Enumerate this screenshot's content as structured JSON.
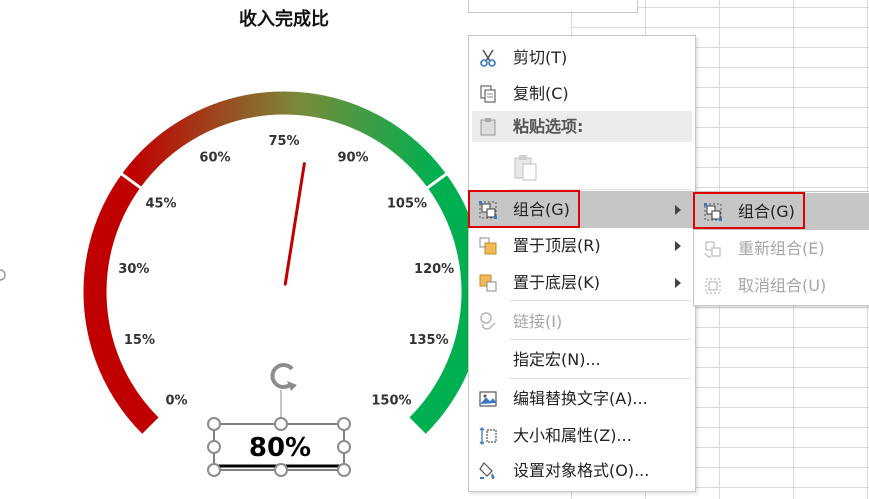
{
  "chart": {
    "title": "收入完成比",
    "value_label": "80%",
    "ticks": [
      "0%",
      "15%",
      "30%",
      "45%",
      "60%",
      "75%",
      "90%",
      "105%",
      "120%",
      "135%",
      "150%"
    ]
  },
  "chart_data": {
    "type": "gauge",
    "title": "收入完成比",
    "value": 80,
    "value_label": "80%",
    "range": [
      0,
      150
    ],
    "tick_labels": [
      "0%",
      "15%",
      "30%",
      "45%",
      "60%",
      "75%",
      "90%",
      "105%",
      "120%",
      "135%",
      "150%"
    ],
    "bands": [
      {
        "from": 0,
        "to": 45,
        "color": "#c00000"
      },
      {
        "from": 45,
        "to": 105,
        "color": "gradient #c00000 → #00b050"
      },
      {
        "from": 105,
        "to": 150,
        "color": "#00b050"
      }
    ],
    "needle_color": "#c00000"
  },
  "context_menu": {
    "cut": "剪切(T)",
    "copy": "复制(C)",
    "paste_options": "粘贴选项:",
    "group": "组合(G)",
    "bring_to_front": "置于顶层(R)",
    "send_to_back": "置于底层(K)",
    "link": "链接(I)",
    "assign_macro": "指定宏(N)...",
    "edit_alt_text": "编辑替换文字(A)...",
    "size_properties": "大小和属性(Z)...",
    "format_object": "设置对象格式(O)..."
  },
  "submenu": {
    "group": "组合(G)",
    "regroup": "重新组合(E)",
    "ungroup": "取消组合(U)"
  },
  "colors": {
    "low": "#c00000",
    "high": "#00b050",
    "highlight": "#c6c6c6",
    "annotation_box": "#e00000"
  },
  "icons": [
    "scissors-icon",
    "copy-icon",
    "clipboard-icon",
    "paste-icon",
    "group-icon",
    "bring-to-front-icon",
    "send-to-back-icon",
    "link-icon",
    "alt-text-icon",
    "size-properties-icon",
    "format-object-icon",
    "regroup-icon",
    "ungroup-icon",
    "rotate-handle-icon"
  ]
}
